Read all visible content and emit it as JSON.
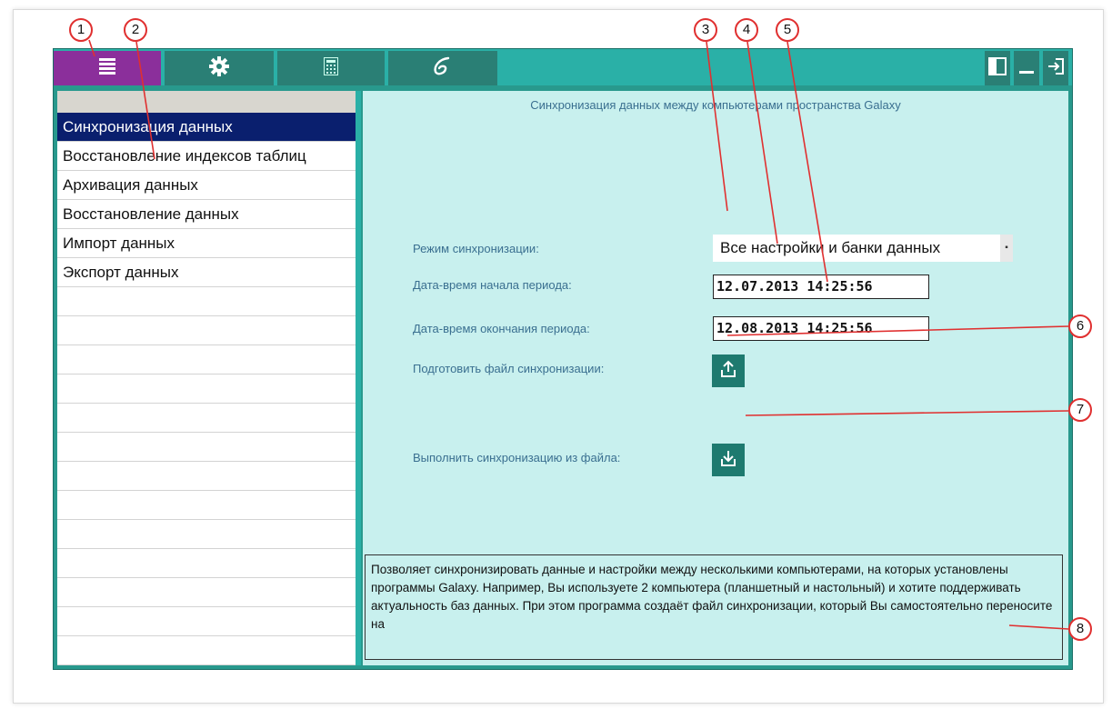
{
  "main": {
    "title": "Синхронизация данных между компьютерами пространства Galaxy",
    "sync_mode_label": "Режим синхронизации:",
    "sync_mode_value": "Все настройки и банки данных",
    "start_label": "Дата-время начала периода:",
    "start_value": "12.07.2013 14:25:56",
    "end_label": "Дата-время окончания периода:",
    "end_value": "12.08.2013 14:25:56",
    "prepare_label": "Подготовить файл синхронизации:",
    "run_label": "Выполнить синхронизацию из файла:",
    "description": "Позволяет синхронизировать данные и настройки между несколькими компьютерами, на которых установлены программы Galaxy. Например, Вы используете 2 компьютера (планшетный и настольный) и хотите поддерживать актуальность баз данных.  При этом программа создаёт файл синхронизации, который Вы самостоятельно переносите на"
  },
  "sidebar": {
    "items": [
      {
        "label": "Синхронизация данных"
      },
      {
        "label": "Восстановление индексов таблиц"
      },
      {
        "label": "Архивация данных"
      },
      {
        "label": "Восстановление данных"
      },
      {
        "label": "Импорт данных"
      },
      {
        "label": "Экспорт данных"
      }
    ],
    "selected_index": 0
  },
  "toolbar": {
    "buttons": [
      "menu-icon",
      "gear-icon",
      "calculator-icon",
      "galaxy-logo-icon"
    ],
    "right_buttons": [
      "panel-toggle-icon",
      "minimize-icon",
      "exit-icon"
    ]
  },
  "callouts": [
    "1",
    "2",
    "3",
    "4",
    "5",
    "6",
    "7",
    "8"
  ],
  "colors": {
    "accent": "#2ab0a7",
    "active_tab": "#8b2f9b",
    "selected_item": "#0a1f6e",
    "content_bg": "#c8f0ee",
    "callout": "#e03030"
  }
}
